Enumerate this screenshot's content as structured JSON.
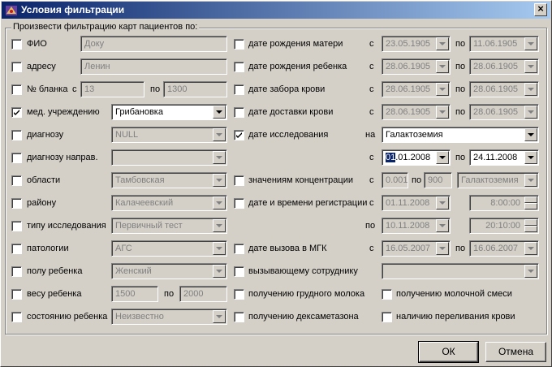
{
  "title": "Условия фильтрации",
  "group_label": "Произвести фильтрацию карт пациентов по:",
  "left": {
    "fio": {
      "label": "ФИО",
      "checked": false,
      "value": "Доку"
    },
    "address": {
      "label": "адресу",
      "checked": false,
      "value": "Ленин"
    },
    "blank": {
      "label": "№ бланка",
      "from_label": "с",
      "from": "13",
      "to_label": "по",
      "to": "1300",
      "checked": false
    },
    "med": {
      "label": "мед. учреждению",
      "checked": true,
      "value": "Грибановка"
    },
    "diag": {
      "label": "диагнозу",
      "checked": false,
      "value": "NULL"
    },
    "diag_napr": {
      "label": "диагнозу направ.",
      "checked": false,
      "value": ""
    },
    "oblast": {
      "label": "области",
      "checked": false,
      "value": "Тамбовская"
    },
    "rayon": {
      "label": "району",
      "checked": false,
      "value": "Калачеевский"
    },
    "tip": {
      "label": "типу исследования",
      "checked": false,
      "value": "Первичный тест"
    },
    "pat": {
      "label": "патологии",
      "checked": false,
      "value": "АГС"
    },
    "pol": {
      "label": "полу ребенка",
      "checked": false,
      "value": "Женский"
    },
    "ves": {
      "label": "весу ребенка",
      "checked": false,
      "from": "1500",
      "to_label": "по",
      "to": "2000"
    },
    "sost": {
      "label": "состоянию ребенка",
      "checked": false,
      "value": "Неизвестно"
    }
  },
  "right": {
    "mother": {
      "label": "дате рождения матери",
      "checked": false,
      "from_label": "с",
      "from": "23.05.1905",
      "to_label": "по",
      "to": "11.06.1905"
    },
    "child": {
      "label": "дате рождения ребенка",
      "checked": false,
      "from_label": "с",
      "from": "28.06.1905",
      "to_label": "по",
      "to": "28.06.1905"
    },
    "zabor": {
      "label": "дате забора крови",
      "checked": false,
      "from_label": "с",
      "from": "28.06.1905",
      "to_label": "по",
      "to": "28.06.1905"
    },
    "dostavka": {
      "label": "дате доставки крови",
      "checked": false,
      "from_label": "с",
      "from": "28.06.1905",
      "to_label": "по",
      "to": "28.06.1905"
    },
    "issl": {
      "label": "дате исследования",
      "checked": true,
      "on_label": "на",
      "on_value": "Галактоземия",
      "from_label": "с",
      "from_sel": "01",
      "from_rest": ".01.2008",
      "to_label": "по",
      "to": "24.11.2008"
    },
    "konc": {
      "label": "значениям концентрации",
      "checked": false,
      "from_label": "с",
      "from": "0.001",
      "to_label": "по",
      "to": "900",
      "value": "Галактоземия"
    },
    "reg": {
      "label": "дате и времени регистрации",
      "checked": false,
      "from_label": "с",
      "from_date": "01.11.2008",
      "from_time": "8:00:00",
      "to_label": "по",
      "to_date": "10.11.2008",
      "to_time": "20:10:00"
    },
    "mgk": {
      "label": "дате вызова в МГК",
      "checked": false,
      "from_label": "с",
      "from": "16.05.2007",
      "to_label": "по",
      "to": "16.06.2007"
    },
    "sotr": {
      "label": "вызывающему сотруднику",
      "checked": false,
      "value": ""
    },
    "grud": {
      "label": "получению  грудного молока",
      "checked": false
    },
    "smes": {
      "label": "получению молочной смеси",
      "checked": false
    },
    "deksa": {
      "label": "получению  дексаметазона",
      "checked": false
    },
    "perel": {
      "label": "наличию переливания крови",
      "checked": false
    }
  },
  "buttons": {
    "ok": "ОК",
    "cancel": "Отмена"
  }
}
